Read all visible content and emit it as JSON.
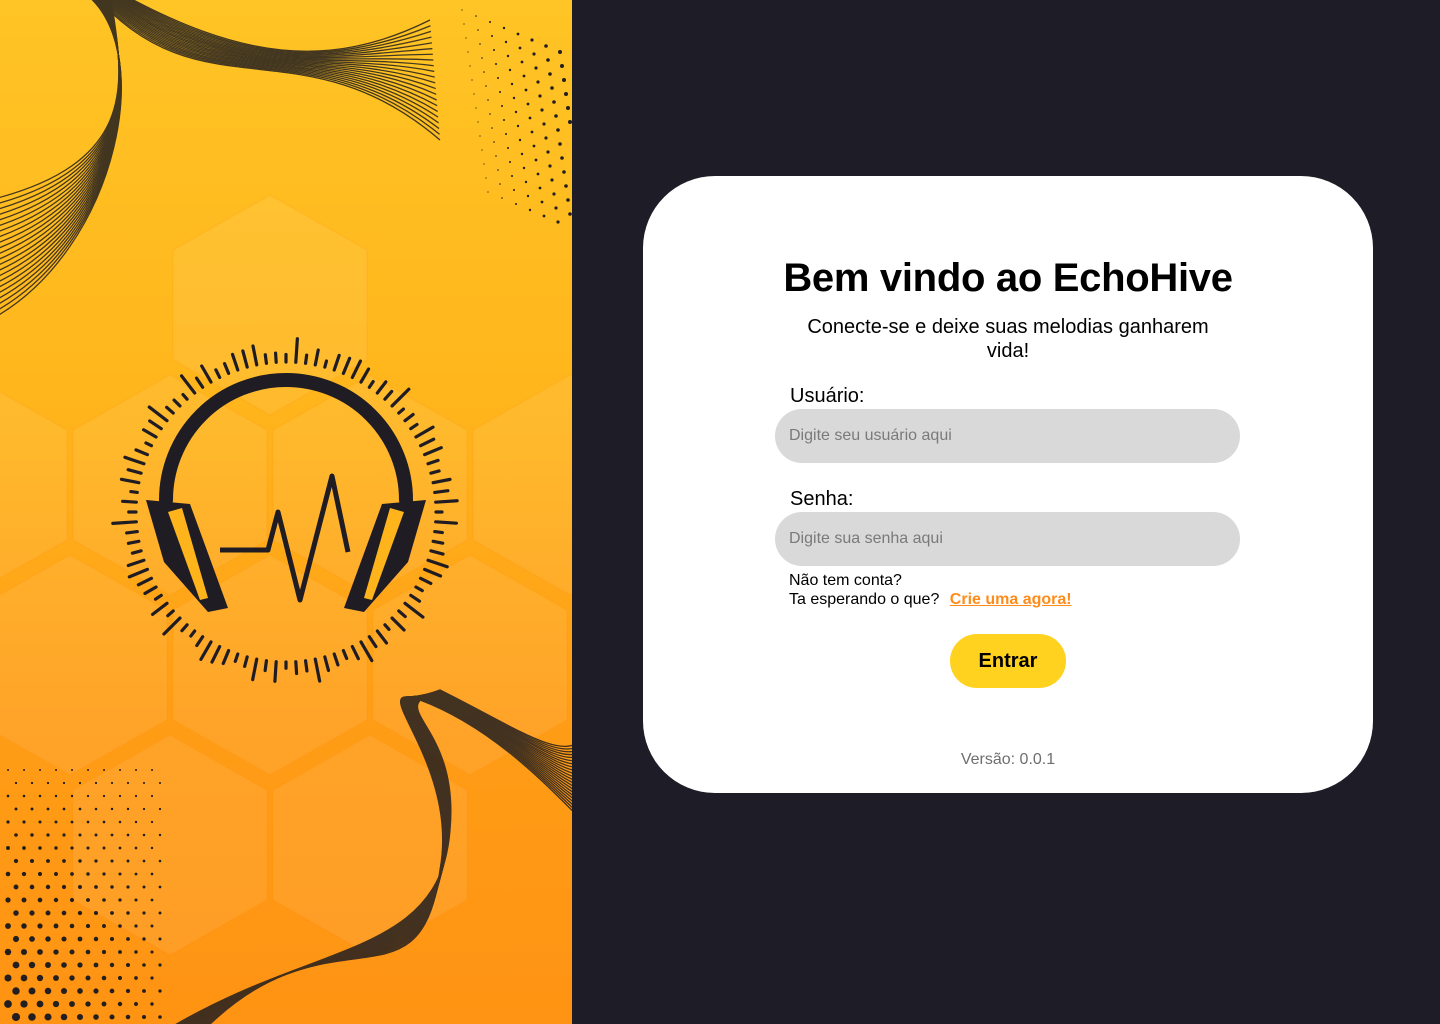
{
  "app": {
    "name": "EchoHive"
  },
  "colors": {
    "accent_yellow": "#ffd21f",
    "link_orange": "#ff8c1a",
    "dark_background": "#1e1c26",
    "input_gray": "#d9d9d9"
  },
  "branding": {
    "logo_icon": "headphones-soundwave-icon"
  },
  "login": {
    "title": "Bem vindo ao EchoHive",
    "subtitle": "Conecte-se e deixe suas melodias ganharem vida!",
    "username_label": "Usuário:",
    "username_placeholder": "Digite seu usuário aqui",
    "username_value": "",
    "password_label": "Senha:",
    "password_placeholder": "Digite sua senha aqui",
    "password_value": "",
    "no_account_line1": "Não tem conta?",
    "no_account_line2": "Ta esperando o que?",
    "signup_link": "Crie uma agora!",
    "submit_label": "Entrar",
    "version": "Versão: 0.0.1"
  }
}
